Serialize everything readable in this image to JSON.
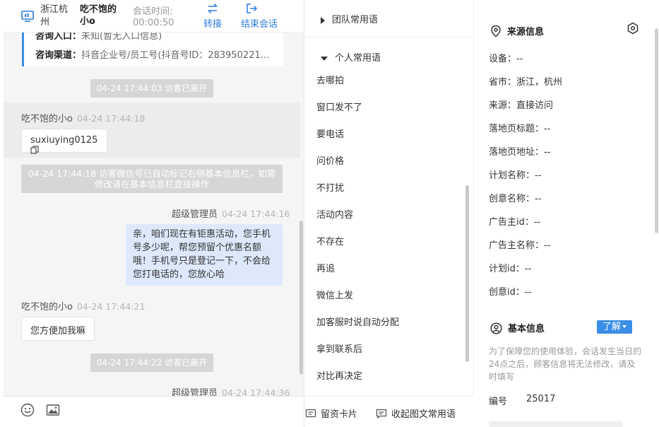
{
  "header": {
    "location": "浙江杭州",
    "visitor_name": "吃不饱的小o",
    "session_time_label": "会话时间:",
    "session_time_value": "00:00:50",
    "transfer_label": "转接",
    "end_session_label": "结束会话"
  },
  "info_card": {
    "entry_key": "咨询入口：",
    "entry_value": "未知(暂无入口信息)",
    "channel_key": "咨询渠道：",
    "channel_value": "抖音企业号/员工号(抖音号ID：283950221..."
  },
  "messages": {
    "sys_left_1": "04-24 17:44:03 访客已离开",
    "visitor_1_name": "吃不饱的小o",
    "visitor_1_time": "04-24 17:44:18",
    "visitor_1_text": "suxiuying0125",
    "sys_wechat_line1": "04-24 17:44:18 访客微信号已自动标记右侧基本信息栏，如需",
    "sys_wechat_line2": "修改请在基本信息栏直接操作",
    "agent_1_name": "超级管理员",
    "agent_1_time": "04-24 17:44:16",
    "agent_1_text": "亲，咱们现在有钜惠活动，您手机号多少呢，帮您预留个优惠名额哦！手机号只是登记一下，不会给您打电话的，您放心哈",
    "visitor_2_name": "吃不饱的小o",
    "visitor_2_time": "04-24 17:44:21",
    "visitor_2_text": "您方便加我嘛",
    "sys_left_2": "04-24 17:44:22 访客已离开",
    "agent_2_name": "超级管理员",
    "agent_2_time": "04-24 17:44:36"
  },
  "phrases": {
    "team_group": "团队常用语",
    "personal_group": "个人常用语",
    "items": [
      "去哪拍",
      "窗口发不了",
      "要电话",
      "问价格",
      "不打扰",
      "活动内容",
      "不存在",
      "再追",
      "微信上发",
      "加客服时说自动分配",
      "拿到联系后",
      "对比再决定"
    ],
    "footer_card": "留资卡片",
    "footer_collapse": "收起图文常用语"
  },
  "source_info": {
    "title": "来源信息",
    "fields": [
      "设备：--",
      "省市：浙江，杭州",
      "来源：直接访问",
      "落地页标题：--",
      "落地页地址：--",
      "计划名称：--",
      "创意名称：--",
      "广告主id：--",
      "广告主名称：--",
      "计划id：--",
      "创意id：--"
    ]
  },
  "basic_info": {
    "title": "基本信息",
    "learn_label": "了解",
    "notice": "为了保障您的使用体验，会话发生当日的24点之后，顾客信息将无法修改，请及时填写",
    "id_label": "编号",
    "id_value": "25017"
  },
  "colors": {
    "accent": "#2b7be0",
    "agent_bubble": "#dde9fb",
    "system_pill": "#d6d6d6"
  }
}
